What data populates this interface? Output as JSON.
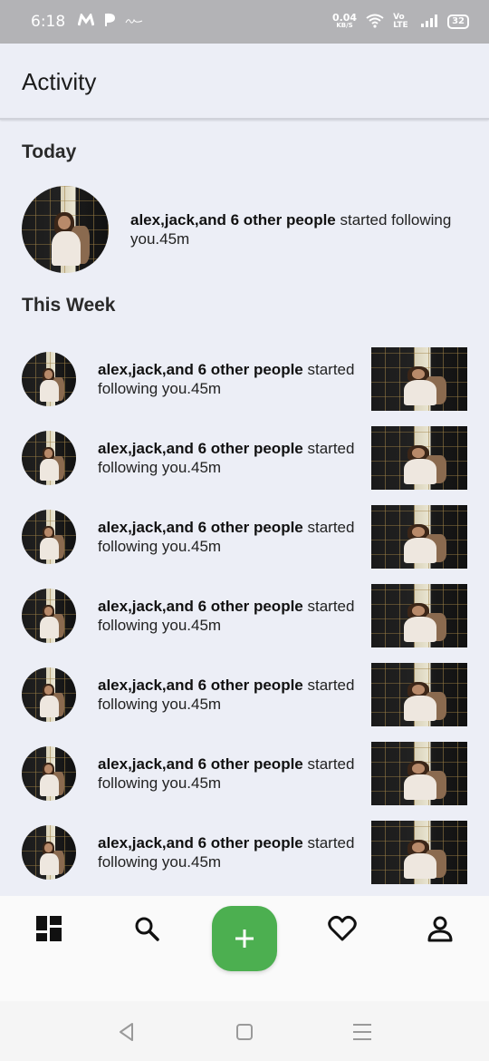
{
  "status_bar": {
    "time": "6:18",
    "net_speed_value": "0.04",
    "net_speed_unit": "KB/S",
    "network": "Vo LTE",
    "battery": "32",
    "app_icons": [
      "m-icon",
      "p-icon",
      "signature-icon"
    ]
  },
  "header": {
    "title": "Activity"
  },
  "today": {
    "title": "Today",
    "item": {
      "bold": "alex,jack,and 6 other people",
      "rest": " started following you.45m"
    }
  },
  "this_week": {
    "title": "This Week",
    "items": [
      {
        "bold": "alex,jack,and 6 other people",
        "rest": " started following you.45m"
      },
      {
        "bold": "alex,jack,and 6 other people",
        "rest": " started following you.45m"
      },
      {
        "bold": "alex,jack,and 6 other people",
        "rest": " started following you.45m"
      },
      {
        "bold": "alex,jack,and 6 other people",
        "rest": " started following you.45m"
      },
      {
        "bold": "alex,jack,and 6 other people",
        "rest": " started following you.45m"
      },
      {
        "bold": "alex,jack,and 6 other people",
        "rest": " started following you.45m"
      },
      {
        "bold": "alex,jack,and 6 other people",
        "rest": " started following you.45m"
      }
    ]
  },
  "bottom_nav": {
    "items": [
      "dashboard-icon",
      "search-icon",
      "add-icon",
      "heart-icon",
      "profile-icon"
    ],
    "fab_color": "#4caf50"
  },
  "system_nav": [
    "back-icon",
    "home-icon",
    "menu-icon"
  ]
}
